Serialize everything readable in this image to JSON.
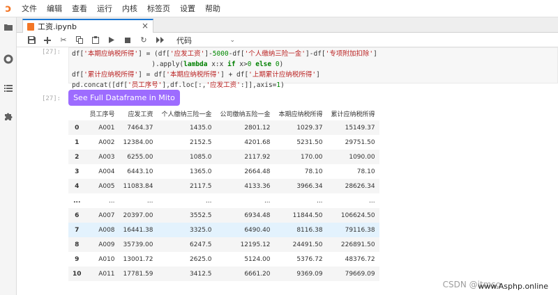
{
  "menubar": {
    "items": [
      "文件",
      "编辑",
      "查看",
      "运行",
      "内核",
      "标签页",
      "设置",
      "帮助"
    ]
  },
  "leftbar": {
    "icons": [
      "folder-icon",
      "running-circle-icon",
      "toc-icon",
      "extension-puzzle-icon"
    ]
  },
  "tab": {
    "label": "工资.ipynb",
    "close": "×"
  },
  "toolbar": {
    "icons": [
      "save-icon",
      "add-cell-icon",
      "cut-icon",
      "copy-icon",
      "paste-icon",
      "run-icon",
      "stop-icon",
      "restart-icon",
      "fast-forward-icon"
    ],
    "cell_type": "代码"
  },
  "cell1": {
    "prompt": "[27]:",
    "lines": [
      "df['本期应纳税所得'] = (df['应发工资']-5000-df['个人缴纳三险一金']-df['专项附加扣除']",
      "                    ).apply(lambda x:x if x>0 else 0)",
      "df['累计应纳税所得'] = df['本期应纳税所得'] + df['上期累计应纳税所得']",
      "pd.concat([df['员工序号'],df.loc[:,'应发工资':]],axis=1)"
    ]
  },
  "cell2": {
    "prompt": "[27]:",
    "mito_button": "See Full Dataframe in Mito"
  },
  "table": {
    "columns": [
      "",
      "员工序号",
      "应发工资",
      "个人缴纳三险一金",
      "公司缴纳五险一金",
      "本期应纳税所得",
      "累计应纳税所得"
    ],
    "rows": [
      [
        "0",
        "A001",
        "7464.37",
        "1435.0",
        "2801.12",
        "1029.37",
        "15149.37"
      ],
      [
        "1",
        "A002",
        "12384.00",
        "2152.5",
        "4201.68",
        "5231.50",
        "29751.50"
      ],
      [
        "2",
        "A003",
        "6255.00",
        "1085.0",
        "2117.92",
        "170.00",
        "1090.00"
      ],
      [
        "3",
        "A004",
        "6443.10",
        "1365.0",
        "2664.48",
        "78.10",
        "78.10"
      ],
      [
        "4",
        "A005",
        "11083.84",
        "2117.5",
        "4133.36",
        "3966.34",
        "28626.34"
      ],
      [
        "...",
        "...",
        "...",
        "...",
        "...",
        "...",
        "..."
      ],
      [
        "6",
        "A007",
        "20397.00",
        "3552.5",
        "6934.48",
        "11844.50",
        "106624.50"
      ],
      [
        "7",
        "A008",
        "16441.38",
        "3325.0",
        "6490.40",
        "8116.38",
        "79116.38"
      ],
      [
        "8",
        "A009",
        "35739.00",
        "6247.5",
        "12195.12",
        "24491.50",
        "226891.50"
      ],
      [
        "9",
        "A010",
        "13001.72",
        "2625.0",
        "5124.00",
        "5376.72",
        "48376.72"
      ],
      [
        "10",
        "A011",
        "17781.59",
        "3412.5",
        "6661.20",
        "9369.09",
        "79669.09"
      ]
    ],
    "highlighted_row": 7
  },
  "watermark": {
    "grey": "CSDN @itmso",
    "site": "www.Asphp.online"
  }
}
